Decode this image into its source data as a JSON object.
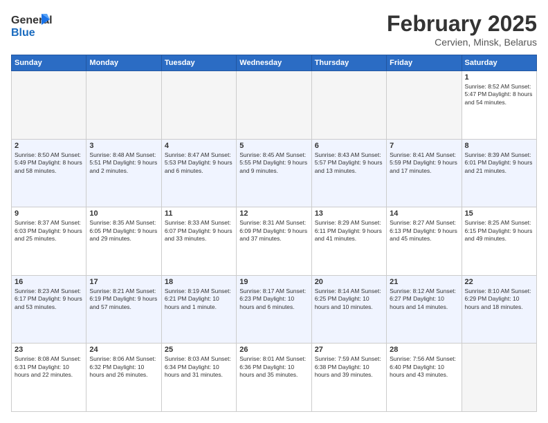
{
  "logo": {
    "line1": "General",
    "line2": "Blue"
  },
  "title": "February 2025",
  "location": "Cervien, Minsk, Belarus",
  "weekdays": [
    "Sunday",
    "Monday",
    "Tuesday",
    "Wednesday",
    "Thursday",
    "Friday",
    "Saturday"
  ],
  "weeks": [
    [
      {
        "day": "",
        "detail": ""
      },
      {
        "day": "",
        "detail": ""
      },
      {
        "day": "",
        "detail": ""
      },
      {
        "day": "",
        "detail": ""
      },
      {
        "day": "",
        "detail": ""
      },
      {
        "day": "",
        "detail": ""
      },
      {
        "day": "1",
        "detail": "Sunrise: 8:52 AM\nSunset: 5:47 PM\nDaylight: 8 hours\nand 54 minutes."
      }
    ],
    [
      {
        "day": "2",
        "detail": "Sunrise: 8:50 AM\nSunset: 5:49 PM\nDaylight: 8 hours\nand 58 minutes."
      },
      {
        "day": "3",
        "detail": "Sunrise: 8:48 AM\nSunset: 5:51 PM\nDaylight: 9 hours\nand 2 minutes."
      },
      {
        "day": "4",
        "detail": "Sunrise: 8:47 AM\nSunset: 5:53 PM\nDaylight: 9 hours\nand 6 minutes."
      },
      {
        "day": "5",
        "detail": "Sunrise: 8:45 AM\nSunset: 5:55 PM\nDaylight: 9 hours\nand 9 minutes."
      },
      {
        "day": "6",
        "detail": "Sunrise: 8:43 AM\nSunset: 5:57 PM\nDaylight: 9 hours\nand 13 minutes."
      },
      {
        "day": "7",
        "detail": "Sunrise: 8:41 AM\nSunset: 5:59 PM\nDaylight: 9 hours\nand 17 minutes."
      },
      {
        "day": "8",
        "detail": "Sunrise: 8:39 AM\nSunset: 6:01 PM\nDaylight: 9 hours\nand 21 minutes."
      }
    ],
    [
      {
        "day": "9",
        "detail": "Sunrise: 8:37 AM\nSunset: 6:03 PM\nDaylight: 9 hours\nand 25 minutes."
      },
      {
        "day": "10",
        "detail": "Sunrise: 8:35 AM\nSunset: 6:05 PM\nDaylight: 9 hours\nand 29 minutes."
      },
      {
        "day": "11",
        "detail": "Sunrise: 8:33 AM\nSunset: 6:07 PM\nDaylight: 9 hours\nand 33 minutes."
      },
      {
        "day": "12",
        "detail": "Sunrise: 8:31 AM\nSunset: 6:09 PM\nDaylight: 9 hours\nand 37 minutes."
      },
      {
        "day": "13",
        "detail": "Sunrise: 8:29 AM\nSunset: 6:11 PM\nDaylight: 9 hours\nand 41 minutes."
      },
      {
        "day": "14",
        "detail": "Sunrise: 8:27 AM\nSunset: 6:13 PM\nDaylight: 9 hours\nand 45 minutes."
      },
      {
        "day": "15",
        "detail": "Sunrise: 8:25 AM\nSunset: 6:15 PM\nDaylight: 9 hours\nand 49 minutes."
      }
    ],
    [
      {
        "day": "16",
        "detail": "Sunrise: 8:23 AM\nSunset: 6:17 PM\nDaylight: 9 hours\nand 53 minutes."
      },
      {
        "day": "17",
        "detail": "Sunrise: 8:21 AM\nSunset: 6:19 PM\nDaylight: 9 hours\nand 57 minutes."
      },
      {
        "day": "18",
        "detail": "Sunrise: 8:19 AM\nSunset: 6:21 PM\nDaylight: 10 hours\nand 1 minute."
      },
      {
        "day": "19",
        "detail": "Sunrise: 8:17 AM\nSunset: 6:23 PM\nDaylight: 10 hours\nand 6 minutes."
      },
      {
        "day": "20",
        "detail": "Sunrise: 8:14 AM\nSunset: 6:25 PM\nDaylight: 10 hours\nand 10 minutes."
      },
      {
        "day": "21",
        "detail": "Sunrise: 8:12 AM\nSunset: 6:27 PM\nDaylight: 10 hours\nand 14 minutes."
      },
      {
        "day": "22",
        "detail": "Sunrise: 8:10 AM\nSunset: 6:29 PM\nDaylight: 10 hours\nand 18 minutes."
      }
    ],
    [
      {
        "day": "23",
        "detail": "Sunrise: 8:08 AM\nSunset: 6:31 PM\nDaylight: 10 hours\nand 22 minutes."
      },
      {
        "day": "24",
        "detail": "Sunrise: 8:06 AM\nSunset: 6:32 PM\nDaylight: 10 hours\nand 26 minutes."
      },
      {
        "day": "25",
        "detail": "Sunrise: 8:03 AM\nSunset: 6:34 PM\nDaylight: 10 hours\nand 31 minutes."
      },
      {
        "day": "26",
        "detail": "Sunrise: 8:01 AM\nSunset: 6:36 PM\nDaylight: 10 hours\nand 35 minutes."
      },
      {
        "day": "27",
        "detail": "Sunrise: 7:59 AM\nSunset: 6:38 PM\nDaylight: 10 hours\nand 39 minutes."
      },
      {
        "day": "28",
        "detail": "Sunrise: 7:56 AM\nSunset: 6:40 PM\nDaylight: 10 hours\nand 43 minutes."
      },
      {
        "day": "",
        "detail": ""
      }
    ]
  ]
}
